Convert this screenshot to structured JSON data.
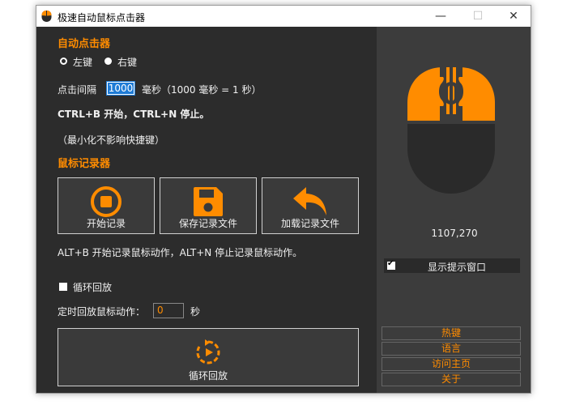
{
  "window": {
    "title": "极速自动鼠标点击器",
    "minimize": "—",
    "maximize": "☐",
    "close": "✕"
  },
  "clicker": {
    "section_title": "自动点击器",
    "left_option": "左键",
    "right_option": "右键",
    "selected": "left",
    "interval_label": "点击间隔",
    "interval_value": "1000",
    "interval_unit": "毫秒（1000 毫秒 = 1 秒）",
    "hotkey_text": "CTRL+B 开始，CTRL+N 停止。",
    "minimize_note": "（最小化不影响快捷键）"
  },
  "recorder": {
    "section_title": "鼠标记录器",
    "start_label": "开始记录",
    "save_label": "保存记录文件",
    "load_label": "加载记录文件",
    "hotkey_text": "ALT+B 开始记录鼠标动作，ALT+N 停止记录鼠标动作。",
    "loop_label": "循环回放",
    "loop_checked": false,
    "timer_label": "定时回放鼠标动作：",
    "timer_value": "0",
    "timer_unit": "秒",
    "replay_label": "循环回放"
  },
  "side": {
    "coordinates": "1107,270",
    "show_tip_label": "显示提示窗口",
    "show_tip_checked": true,
    "links": [
      "热键",
      "语言",
      "访问主页",
      "关于"
    ]
  },
  "colors": {
    "accent": "#ff8c00",
    "panel_dark": "#2c2c2c",
    "panel_side": "#3c3c3c",
    "mouse_body": "#2a2a2a"
  },
  "icons": {
    "app": "mouse-icon",
    "start_record": "record-icon",
    "save_record": "floppy-disk-icon",
    "load_record": "undo-arrow-icon",
    "replay": "replay-icon",
    "mouse_graphic": "mouse-illustration"
  }
}
